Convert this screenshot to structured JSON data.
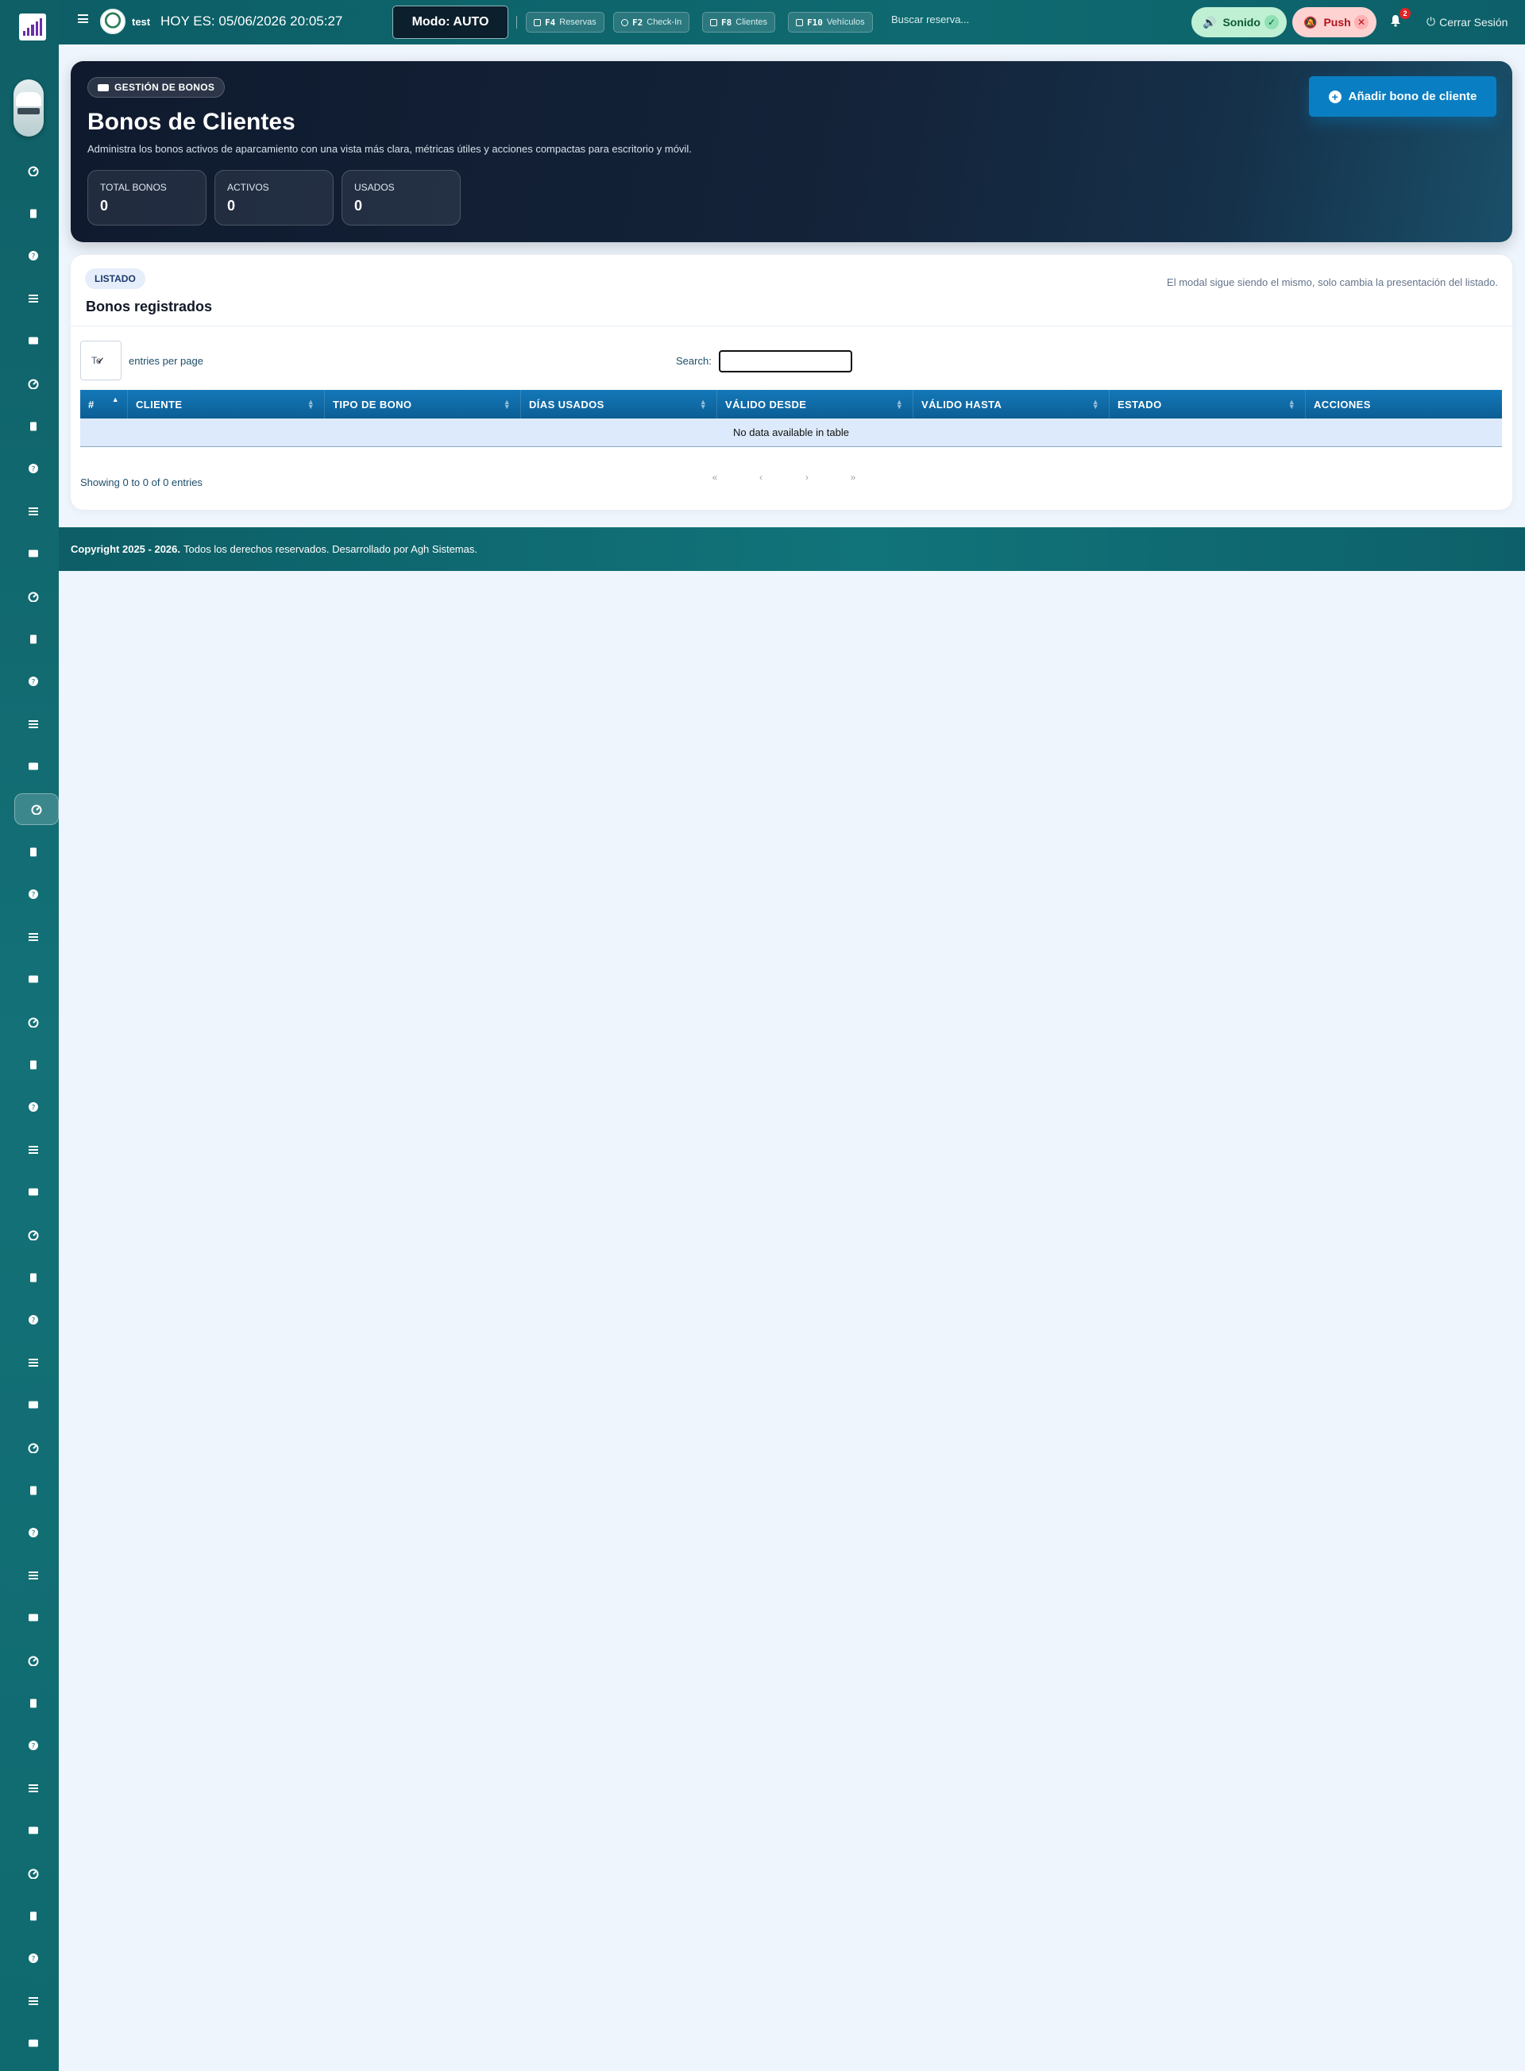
{
  "topbar": {
    "user": "test",
    "date_text": "HOY ES: 05/06/2026 20:05:27",
    "mode": "Modo: AUTO",
    "shortcuts": [
      {
        "key": "F4",
        "label": "Reservas"
      },
      {
        "key": "F2",
        "label": "Check-In"
      },
      {
        "key": "F8",
        "label": "Clientes"
      },
      {
        "key": "F10",
        "label": "Vehículos"
      }
    ],
    "search_placeholder": "Buscar reserva...",
    "sound_label": "Sonido",
    "push_label": "Push",
    "notif_count": "2",
    "logout_label": "Cerrar Sesión"
  },
  "sidebar": {
    "active_index": 15,
    "icons": [
      "dashboard-icon",
      "document-icon",
      "help-icon",
      "list-icon",
      "id-card-icon",
      "car-icon",
      "truck-icon",
      "layers-icon",
      "transfer-icon",
      "euro-icon",
      "chart-icon",
      "calendar-icon",
      "calendar-check-icon",
      "calendar-x-icon",
      "building-icon",
      "ticket-icon",
      "file-icon",
      "camera-icon",
      "megaphone-icon",
      "parking-icon",
      "check-icon",
      "logout-arrow-icon",
      "printer-icon",
      "file-text-icon",
      "users-icon",
      "clock-icon",
      "user-cog-icon",
      "briefcase-icon",
      "list-alt-icon",
      "database-icon",
      "bell-icon",
      "user-icon",
      "cogs-icon",
      "bank-icon",
      "video-icon",
      "book-icon",
      "user-tie-icon",
      "shield-icon",
      "network-icon",
      "server-icon",
      "sitemap-icon",
      "list-check-icon",
      "code-icon",
      "antenna-icon",
      "power-icon"
    ]
  },
  "hero": {
    "tag": "GESTIÓN DE BONOS",
    "title": "Bonos de Clientes",
    "subtitle": "Administra los bonos activos de aparcamiento con una vista más clara, métricas útiles y acciones compactas para escritorio y móvil.",
    "stats": [
      {
        "label": "TOTAL BONOS",
        "value": "0"
      },
      {
        "label": "ACTIVOS",
        "value": "0"
      },
      {
        "label": "USADOS",
        "value": "0"
      }
    ],
    "add_button": "Añadir bono de cliente"
  },
  "listing": {
    "tag": "LISTADO",
    "title": "Bonos registrados",
    "note": "El modal sigue siendo el mismo, solo cambia la presentación del listado.",
    "length_value": "Te",
    "length_label": "entries per page",
    "search_label": "Search:",
    "columns": [
      "#",
      "CLIENTE",
      "TIPO DE BONO",
      "DÍAS USADOS",
      "VÁLIDO DESDE",
      "VÁLIDO HASTA",
      "ESTADO",
      "ACCIONES"
    ],
    "empty_text": "No data available in table",
    "info": "Showing 0 to 0 of 0 entries",
    "pager": [
      "«",
      "‹",
      "›",
      "»"
    ]
  },
  "footer": {
    "copyright": "Copyright 2025 - 2026.",
    "text": "Todos los derechos reservados. Desarrollado por Agh Sistemas."
  },
  "colors": {
    "topbar": "#0d5e66",
    "sidebar": "#137177",
    "hero_bg": "#142339",
    "primary_button": "#0a7ec2",
    "table_header": "#1478b8",
    "empty_row": "#dceafb",
    "sound_pill": "#bff0d4",
    "push_pill": "#ffd2d2"
  }
}
